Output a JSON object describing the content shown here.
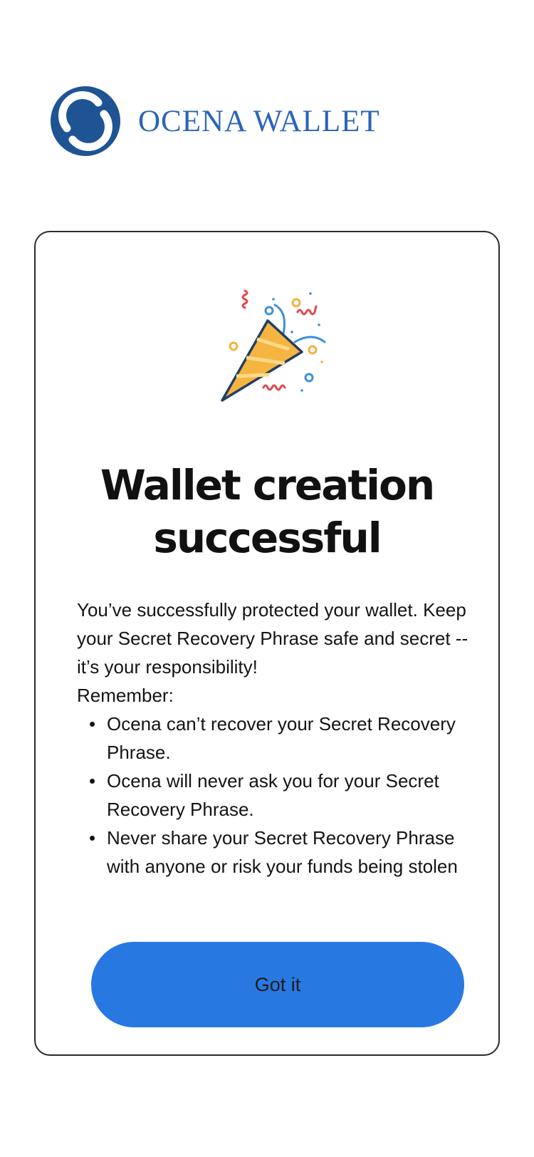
{
  "header": {
    "logo_icon": "ocena-logo-icon",
    "brand_name": "OCENA WALLET"
  },
  "card": {
    "illustration_icon": "party-popper-icon",
    "title": "Wallet creation successful",
    "intro": "You’ve successfully protected your wallet. Keep your Secret Recovery Phrase safe and secret -- it’s your responsibility!",
    "remember_label": "Remember:",
    "bullets": [
      "Ocena can’t recover your Secret Recovery Phrase.",
      "Ocena will never ask you for your Secret Recovery Phrase.",
      "Never share your Secret Recovery Phrase with anyone or risk your funds being stolen"
    ],
    "button_label": "Got it"
  },
  "colors": {
    "brand": "#2a64b8",
    "logo_dark": "#1e5494",
    "button": "#2878e2",
    "card_border": "#2b2b2b",
    "confetti_red": "#e2474a",
    "confetti_yellow": "#f2b33d",
    "confetti_blue": "#3f8fd6",
    "cone_outline": "#1f3f63"
  }
}
